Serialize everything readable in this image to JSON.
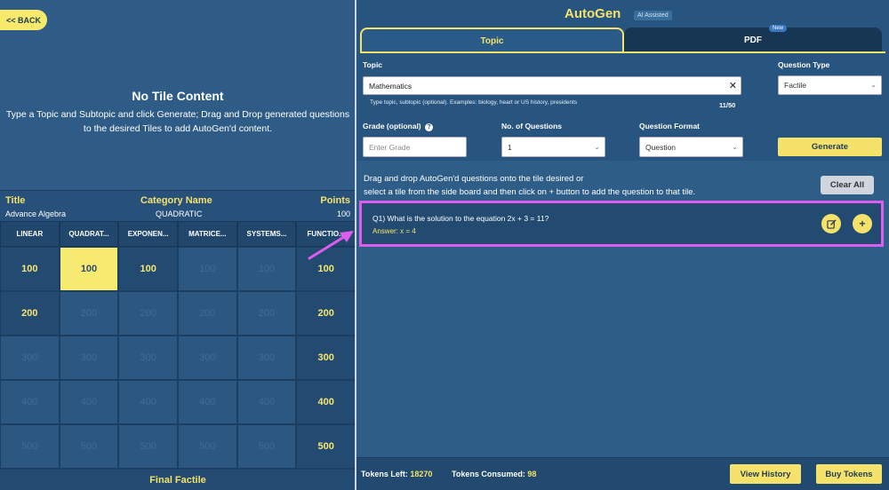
{
  "left": {
    "back_label": "<< BACK",
    "notile_title": "No Tile Content",
    "notile_desc_1": "Type a Topic and Subtopic and click Generate; Drag and Drop generated questions",
    "notile_desc_2": "to the desired Tiles to add AutoGen'd content.",
    "info": {
      "title_label": "Title",
      "category_label": "Category Name",
      "points_label": "Points",
      "title_value": "Advance Algebra",
      "category_value": "QUADRATIC",
      "points_value": "100"
    },
    "columns": [
      "LINEAR",
      "QUADRAT...",
      "EXPONEN...",
      "MATRICE...",
      "SYSTEMS...",
      "FUNCTIO..."
    ],
    "rows": [
      [
        "100",
        "100",
        "100",
        "100",
        "100",
        "100"
      ],
      [
        "200",
        "200",
        "200",
        "200",
        "200",
        "200"
      ],
      [
        "300",
        "300",
        "300",
        "300",
        "300",
        "300"
      ],
      [
        "400",
        "400",
        "400",
        "400",
        "400",
        "400"
      ],
      [
        "500",
        "500",
        "500",
        "500",
        "500",
        "500"
      ]
    ],
    "final_label": "Final Factile"
  },
  "right": {
    "app_title": "AutoGen",
    "ai_badge": "AI Assisted",
    "tab_topic": "Topic",
    "tab_pdf": "PDF",
    "new_badge": "New",
    "topic_label": "Topic",
    "topic_value": "Mathematics",
    "topic_hint": "Type topic, subtopic (optional). Examples: biology, heart or US history, presidents",
    "topic_count": "11/50",
    "question_type_label": "Question Type",
    "question_type_value": "Factile",
    "grade_label": "Grade (optional)",
    "grade_placeholder": "Enter Grade",
    "num_questions_label": "No. of Questions",
    "num_questions_value": "1",
    "format_label": "Question Format",
    "format_value": "Question",
    "generate_label": "Generate",
    "dd_line1": "Drag and drop AutoGen'd questions onto the tile desired or",
    "dd_line2": "select a tile from the side board and then click on + button to add the question to that tile.",
    "clear_all_label": "Clear All",
    "question": "Q1) What is the solution to the equation 2x + 3 = 11?",
    "answer": "Answer: x = 4",
    "tokens_left_label": "Tokens Left:",
    "tokens_left_value": "18270",
    "tokens_consumed_label": "Tokens Consumed:",
    "tokens_consumed_value": "98",
    "view_history_label": "View History",
    "buy_tokens_label": "Buy Tokens"
  },
  "colors": {
    "accent": "#f4e26a",
    "highlight": "#e05cf0",
    "panel": "#2e5c86"
  }
}
